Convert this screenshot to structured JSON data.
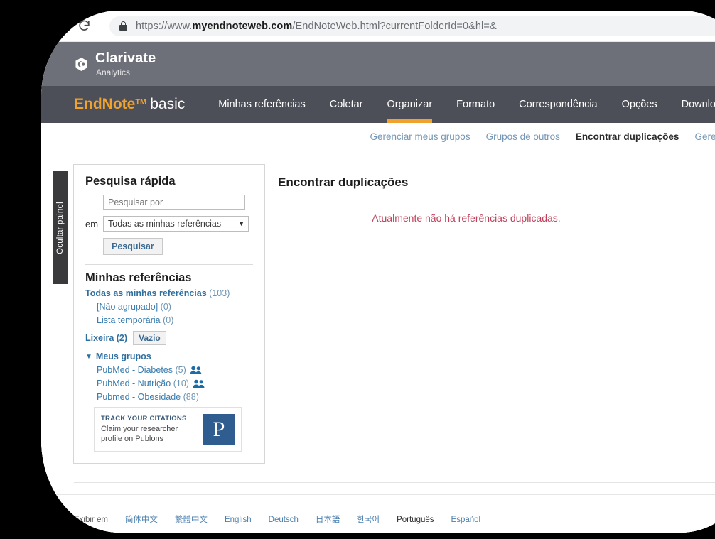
{
  "browser": {
    "reload_icon": "reload-icon",
    "lock_icon": "lock-icon",
    "url_prefix": "https://www.",
    "url_domain": "myendnoteweb.com",
    "url_path": "/EndNoteWeb.html?currentFolderId=0&hl=&"
  },
  "brand": {
    "name": "Clarivate",
    "sub": "Analytics",
    "mark_icon": "clarivate-logo-icon"
  },
  "nav": {
    "logo_endnote": "EndNote",
    "logo_tm": "TM",
    "logo_basic": "basic",
    "items": [
      {
        "label": "Minhas referências",
        "active": false
      },
      {
        "label": "Coletar",
        "active": false
      },
      {
        "label": "Organizar",
        "active": true
      },
      {
        "label": "Formato",
        "active": false
      },
      {
        "label": "Correspondência",
        "active": false
      },
      {
        "label": "Opções",
        "active": false
      },
      {
        "label": "Downloads",
        "active": false
      }
    ]
  },
  "subnav": {
    "items": [
      {
        "label": "Gerenciar meus grupos",
        "active": false
      },
      {
        "label": "Grupos de outros",
        "active": false
      },
      {
        "label": "Encontrar duplicações",
        "active": true
      },
      {
        "label": "Gerenciar anexos",
        "active": false
      }
    ]
  },
  "hide_panel": {
    "label": "Ocultar painel"
  },
  "quick_search": {
    "heading": "Pesquisa rápida",
    "placeholder": "Pesquisar por",
    "value": "",
    "in_label": "em",
    "scope_selected": "Todas as minhas referências",
    "caret_icon": "chevron-down-icon",
    "button": "Pesquisar"
  },
  "my_references": {
    "heading": "Minhas referências",
    "all_label": "Todas as minhas referências",
    "all_count": "(103)",
    "sub_items": [
      {
        "label": "[Não agrupado]",
        "count": "(0)"
      },
      {
        "label": "Lista temporária",
        "count": "(0)"
      }
    ],
    "trash_label": "Lixeira (2)",
    "trash_button": "Vazio",
    "groups_toggle_icon": "triangle-down-icon",
    "groups_heading": "Meus grupos",
    "groups": [
      {
        "label": "PubMed - Diabetes",
        "count": "(5)",
        "shared": true,
        "shared_icon": "people-icon"
      },
      {
        "label": "PubMed - Nutrição",
        "count": "(10)",
        "shared": true,
        "shared_icon": "people-icon"
      },
      {
        "label": "Pubmed - Obesidade",
        "count": "(88)",
        "shared": false,
        "shared_icon": ""
      }
    ]
  },
  "promo": {
    "title": "TRACK YOUR CITATIONS",
    "line1": "Claim your researcher",
    "line2": "profile on Publons",
    "logo_letter": "P",
    "logo_icon": "publons-logo-icon"
  },
  "main": {
    "title": "Encontrar duplicações",
    "message": "Atualmente não há referências duplicadas."
  },
  "footer": {
    "label": "Exibir em",
    "languages": [
      {
        "label": "简体中文",
        "active": false
      },
      {
        "label": "繁體中文",
        "active": false
      },
      {
        "label": "English",
        "active": false
      },
      {
        "label": "Deutsch",
        "active": false
      },
      {
        "label": "日本語",
        "active": false
      },
      {
        "label": "한국어",
        "active": false
      },
      {
        "label": "Português",
        "active": true
      },
      {
        "label": "Español",
        "active": false
      }
    ]
  },
  "colors": {
    "accent_orange": "#f0a22e",
    "nav_bg": "#4c4f58",
    "brand_bg": "#6e7079",
    "link_blue": "#3a7cae",
    "alert_red": "#c0405a",
    "publons_blue": "#2f5d8f"
  }
}
